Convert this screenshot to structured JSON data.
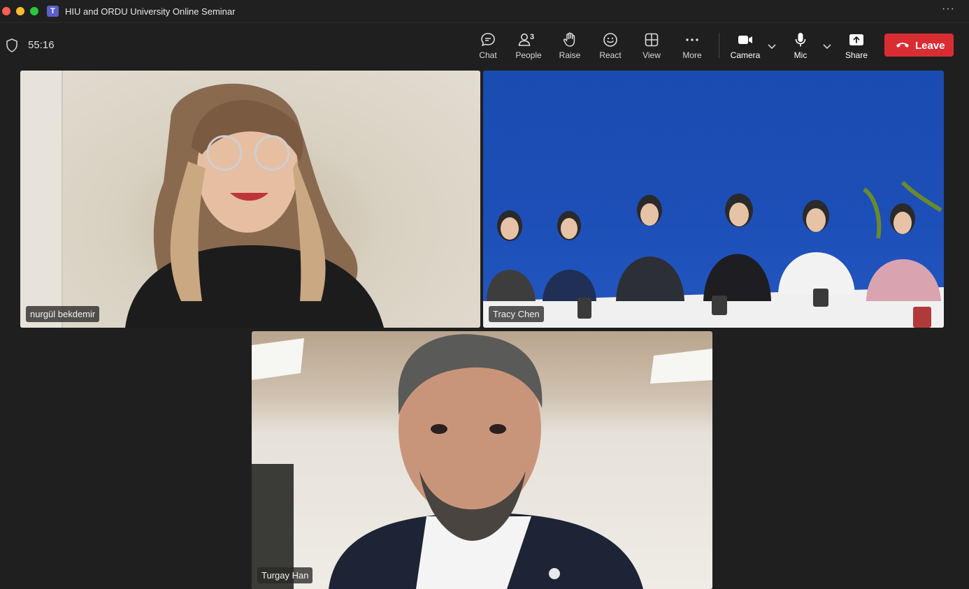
{
  "window": {
    "title": "HIU and ORDU University Online Seminar"
  },
  "meeting": {
    "elapsed": "55:16"
  },
  "toolbar": {
    "chat": "Chat",
    "people": "People",
    "people_count": "3",
    "raise": "Raise",
    "react": "React",
    "view": "View",
    "more": "More",
    "camera": "Camera",
    "mic": "Mic",
    "share": "Share",
    "leave": "Leave"
  },
  "participants": [
    {
      "name": "nurgül bekdemir"
    },
    {
      "name": "Tracy Chen"
    },
    {
      "name": "Turgay Han"
    }
  ],
  "colors": {
    "leave": "#d92d34",
    "app_logo": "#5b5fc7",
    "background": "#1f1f1f"
  }
}
